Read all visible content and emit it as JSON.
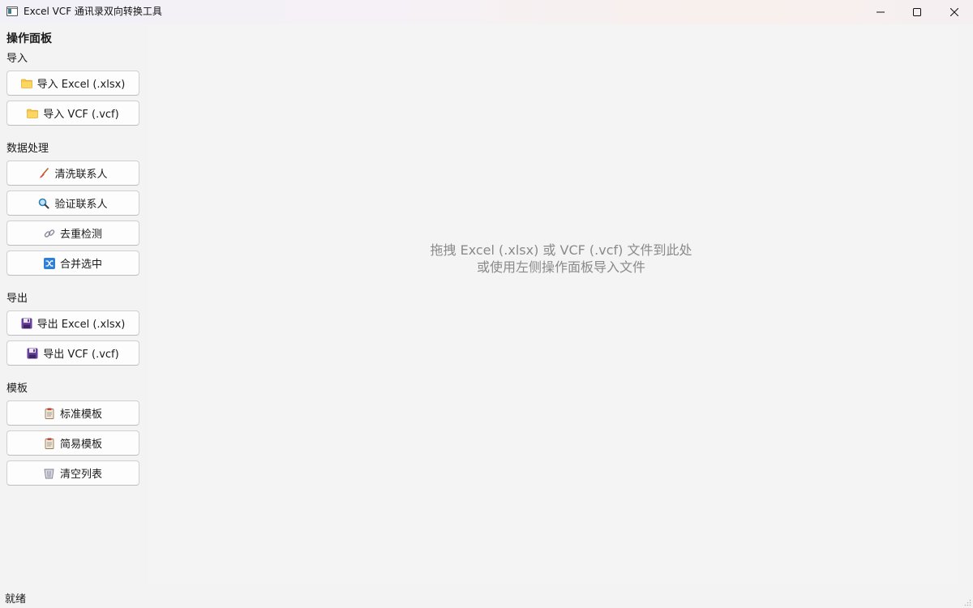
{
  "window": {
    "title": "Excel VCF 通讯录双向转换工具",
    "controls": {
      "minimize": "minimize",
      "maximize": "maximize",
      "close": "close"
    }
  },
  "sidebar": {
    "title": "操作面板",
    "groups": [
      {
        "label": "导入",
        "buttons": [
          {
            "label": "导入 Excel (.xlsx)",
            "icon": "folder-icon"
          },
          {
            "label": "导入 VCF (.vcf)",
            "icon": "folder-icon"
          }
        ]
      },
      {
        "label": "数据处理",
        "buttons": [
          {
            "label": "清洗联系人",
            "icon": "broom-icon"
          },
          {
            "label": "验证联系人",
            "icon": "magnifier-icon"
          },
          {
            "label": "去重检测",
            "icon": "link-icon"
          },
          {
            "label": "合并选中",
            "icon": "shuffle-icon"
          }
        ]
      },
      {
        "label": "导出",
        "buttons": [
          {
            "label": "导出 Excel (.xlsx)",
            "icon": "floppy-disk-icon"
          },
          {
            "label": "导出 VCF (.vcf)",
            "icon": "floppy-disk-icon"
          }
        ]
      },
      {
        "label": "模板",
        "buttons": [
          {
            "label": "标准模板",
            "icon": "clipboard-icon"
          },
          {
            "label": "简易模板",
            "icon": "clipboard-icon"
          },
          {
            "label": "清空列表",
            "icon": "wastebasket-icon"
          }
        ]
      }
    ]
  },
  "main": {
    "drop_hint_line1": "拖拽 Excel (.xlsx) 或 VCF (.vcf) 文件到此处",
    "drop_hint_line2": "或使用左侧操作面板导入文件"
  },
  "status": {
    "text": "就绪"
  },
  "colors": {
    "folder": "#f7c948",
    "floppy": "#6b3fa0",
    "hint_text": "#8a8a8a"
  }
}
